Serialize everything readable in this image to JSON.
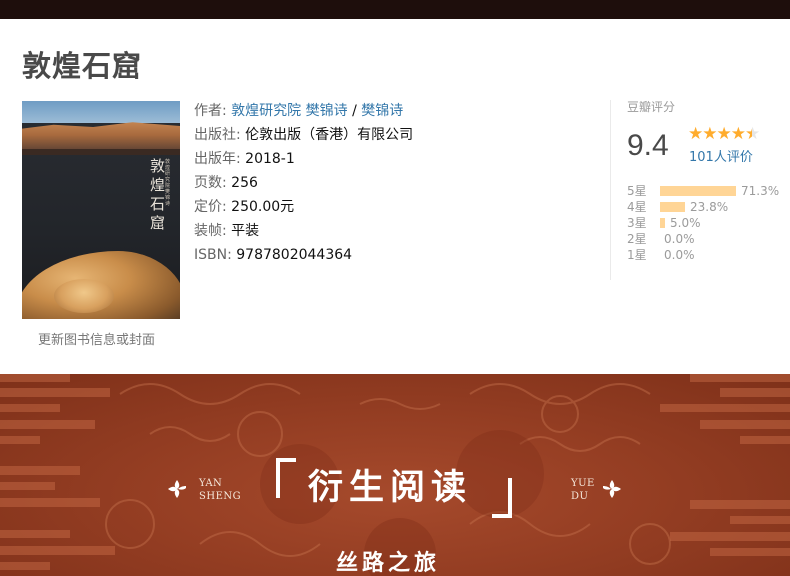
{
  "book": {
    "title": "敦煌石窟",
    "cover_title": "敦煌石窟",
    "cover_small": "敦煌研究院 樊锦诗",
    "update_link": "更新图书信息或封面"
  },
  "info": {
    "author_label": "作者:",
    "author_1": "敦煌研究院",
    "author_2": "樊锦诗",
    "author_sep": "/",
    "author_3": "樊锦诗",
    "publisher_label": "出版社:",
    "publisher": "伦敦出版（香港）有限公司",
    "year_label": "出版年:",
    "year": "2018-1",
    "pages_label": "页数:",
    "pages": "256",
    "price_label": "定价:",
    "price": "250.00元",
    "binding_label": "装帧:",
    "binding": "平装",
    "isbn_label": "ISBN:",
    "isbn": "9787802044364"
  },
  "rating": {
    "label": "豆瓣评分",
    "score": "9.4",
    "stars": 4.5,
    "votes": "101人评价",
    "distribution": [
      {
        "name": "5星",
        "pct": "71.3%",
        "value": 71.3
      },
      {
        "name": "4星",
        "pct": "23.8%",
        "value": 23.8
      },
      {
        "name": "3星",
        "pct": "5.0%",
        "value": 5.0
      },
      {
        "name": "2星",
        "pct": "0.0%",
        "value": 0.0
      },
      {
        "name": "1星",
        "pct": "0.0%",
        "value": 0.0
      }
    ]
  },
  "banner": {
    "left_line1": "YAN",
    "left_line2": "SHENG",
    "title": "衍生阅读",
    "right_line1": "YUE",
    "right_line2": "DU",
    "subtitle": "丝路之旅"
  },
  "colors": {
    "link": "#3377aa",
    "star": "#ffac2d",
    "bar": "#ffd596",
    "banner": "#953e23",
    "top_bar": "#1e0e0c"
  }
}
